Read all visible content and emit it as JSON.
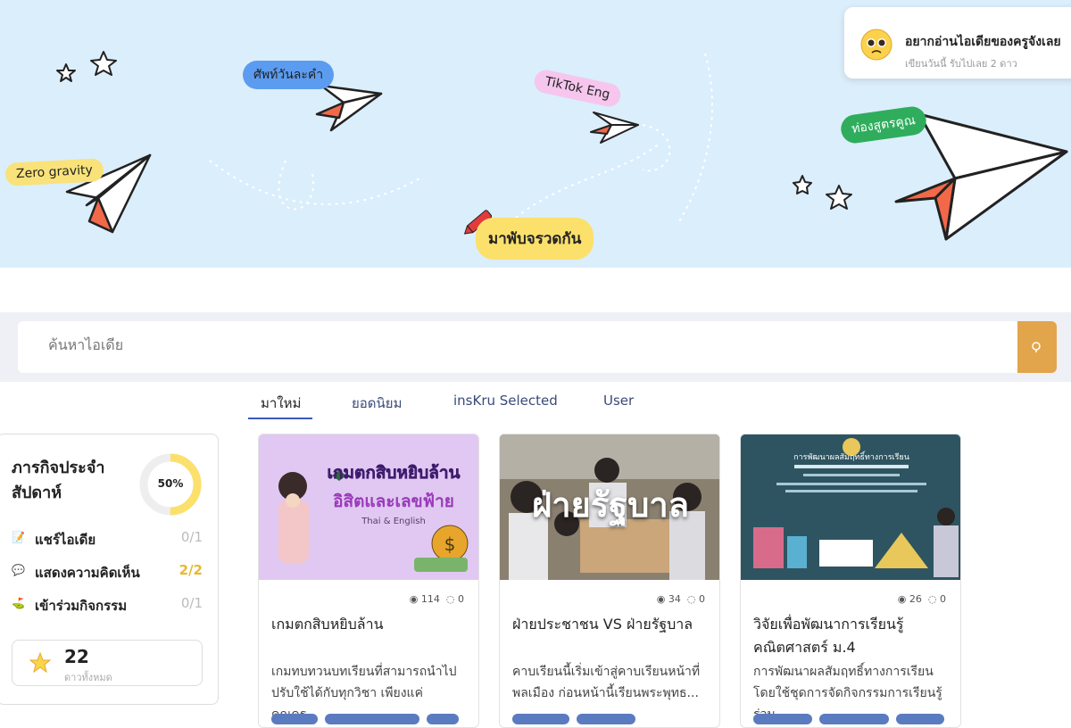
{
  "hero": {
    "tags": {
      "zero_gravity": "Zero gravity",
      "word_of_day": "ศัพท์วันละคำ",
      "tiktok_eng": "TikTok Eng",
      "formula": "ท่องสูตรคูณ"
    },
    "cta_label": "มาพับจรวดกัน",
    "colors": {
      "background": "#dbeefb",
      "accent": "#f2694a"
    }
  },
  "notice": {
    "title": "อยากอ่านไอเดียของครูจังเลย",
    "subtitle": "เขียนวันนี้ รับไปเลย 2 ดาว",
    "icon": "pleading-face-icon"
  },
  "search": {
    "placeholder": "ค้นหาไอเดีย",
    "button_icon": "search-icon"
  },
  "tabs": [
    {
      "label": "มาใหม่",
      "active": true
    },
    {
      "label": "ยอดนิยม",
      "active": false
    },
    {
      "label": "insKru Selected",
      "active": false
    },
    {
      "label": "User",
      "active": false
    }
  ],
  "mission": {
    "title": "ภารกิจประจำสัปดาห์",
    "progress_label": "50%",
    "progress": 0.5,
    "tasks": [
      {
        "icon": "memo-icon",
        "label": "แชร์ไอเดีย",
        "count": "0/1"
      },
      {
        "icon": "speech-bubble-icon",
        "label": "แสดงความคิดเห็น",
        "count": "2/2"
      },
      {
        "icon": "golf-flag-icon",
        "label": "เข้าร่วมกิจกรรม",
        "count": "0/1"
      }
    ],
    "stars_total": "22",
    "stars_label": "ดาวทั้งหมด"
  },
  "cards": [
    {
      "thumb_title": "เกมตกสิบหยิบล้าน",
      "thumb_subtitle": "อิสิตและเลขฟ้าย",
      "thumb_note": "Thai & English",
      "views": "114",
      "comments": "0",
      "title": "เกมตกสิบหยิบล้าน",
      "description": "เกมทบทวนบทเรียนที่สามารถนำไปปรับใช้ได้กับทุกวิชา เพียงแค่คุณครู..."
    },
    {
      "thumb_title": "ฝ่ายรัฐบาล",
      "views": "34",
      "comments": "0",
      "title": "ฝ่ายประชาชน VS ฝ่ายรัฐบาล",
      "description": "คาบเรียนนี้เริ่มเข้าสู่คาบเรียนหน้าที่พลเมือง ก่อนหน้านี้เรียนพระพุทธ..."
    },
    {
      "thumb_title": "การพัฒนาผลสัมฤทธิ์ทางการเรียน",
      "views": "26",
      "comments": "0",
      "title": "วิจัยเพื่อพัฒนาการเรียนรู้คณิตศาสตร์ ม.4",
      "description": "การพัฒนาผลสัมฤทธิ์ทางการเรียนโดยใช้ชุดการจัดกิจกรรมการเรียนรู้ ร่วม..."
    }
  ]
}
